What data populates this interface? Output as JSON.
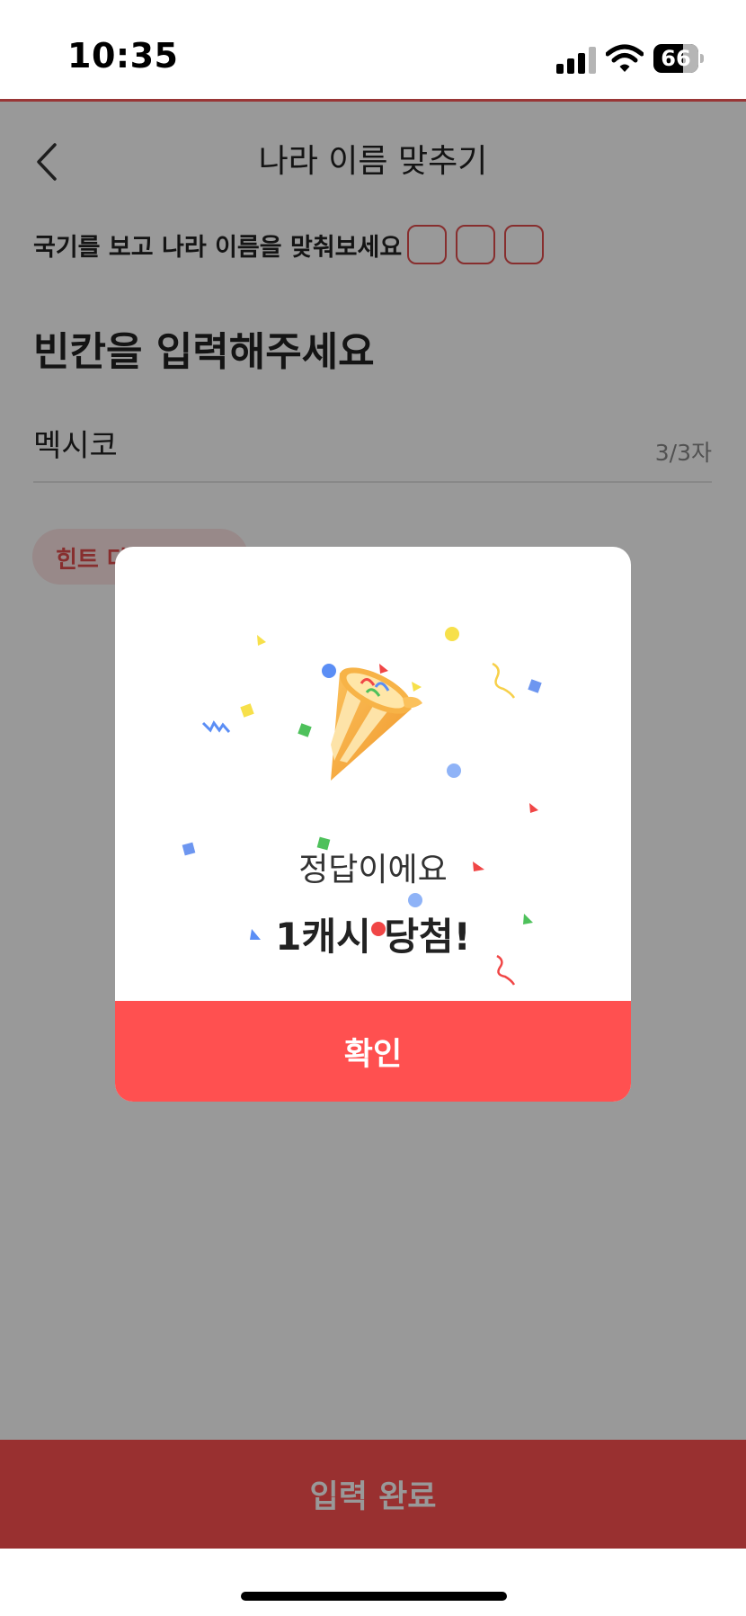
{
  "status_bar": {
    "time": "10:35",
    "battery": "66"
  },
  "header": {
    "title": "나라 이름 맞추기"
  },
  "quiz": {
    "instruction": "국기를 보고 나라 이름을 맞춰보세요",
    "prompt": "빈칸을 입력해주세요",
    "answer_value": "멕시코",
    "char_count": "3/3자",
    "hint_button": "힌트 다시 보기"
  },
  "submit_button": "입력 완료",
  "dialog": {
    "message": "정답이에요",
    "reward": "1캐시 당첨!",
    "confirm_button": "확인"
  },
  "colors": {
    "accent": "#ff5050",
    "hint_bg": "#fde4e4",
    "overlay": "rgba(0,0,0,0.4)"
  }
}
